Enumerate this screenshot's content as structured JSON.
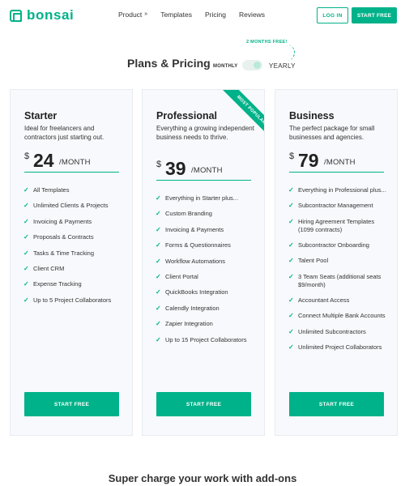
{
  "header": {
    "logo_text": "bonsai",
    "nav": [
      {
        "label": "Product",
        "chevron": "»"
      },
      {
        "label": "Templates"
      },
      {
        "label": "Pricing"
      },
      {
        "label": "Reviews"
      }
    ],
    "login_label": "LOG IN",
    "start_free_label": "START FREE"
  },
  "pricing": {
    "title": "Plans & Pricing",
    "monthly_label": "MONTHLY",
    "yearly_label": "YEARLY",
    "promo": "2 MONTHS FREE!"
  },
  "plans": [
    {
      "name": "Starter",
      "description": "Ideal for freelancers and contractors just starting out.",
      "currency": "$",
      "price": "24",
      "per": "/MONTH",
      "features": [
        "All Templates",
        "Unlimited Clients & Projects",
        "Invoicing & Payments",
        "Proposals & Contracts",
        "Tasks & Time Tracking",
        "Client CRM",
        "Expense Tracking",
        "Up to 5 Project Collaborators"
      ],
      "button": "START FREE"
    },
    {
      "name": "Professional",
      "description": "Everything a growing independent business needs to thrive.",
      "currency": "$",
      "price": "39",
      "per": "/MONTH",
      "ribbon": "MOST POPULAR",
      "features": [
        "Everything in Starter plus...",
        "Custom Branding",
        "Invoicing & Payments",
        "Forms & Questionnaires",
        "Workflow Automations",
        "Client Portal",
        "QuickBooks Integration",
        "Calendly Integration",
        "Zapier Integration",
        "Up to 15 Project Collaborators"
      ],
      "button": "START FREE"
    },
    {
      "name": "Business",
      "description": "The perfect package for small businesses and agencies.",
      "currency": "$",
      "price": "79",
      "per": "/MONTH",
      "features": [
        "Everything in Professional plus...",
        "Subcontractor Management",
        "Hiring Agreement Templates (1099 contracts)",
        "Subcontractor Onboarding",
        "Talent Pool",
        "3 Team Seats (additional seats $9/month)",
        "Accountant Access",
        "Connect Multiple Bank Accounts",
        "Unlimited Subcontractors",
        "Unlimited Project Collaborators"
      ],
      "button": "START FREE"
    }
  ],
  "addons_title": "Super charge your work with add-ons",
  "colors": {
    "brand": "#00b289",
    "card_bg": "#f7f9fc"
  },
  "icons": {
    "logo": "bonsai-logo-icon",
    "check": "check-icon",
    "chevron": "chevron-down-icon"
  }
}
